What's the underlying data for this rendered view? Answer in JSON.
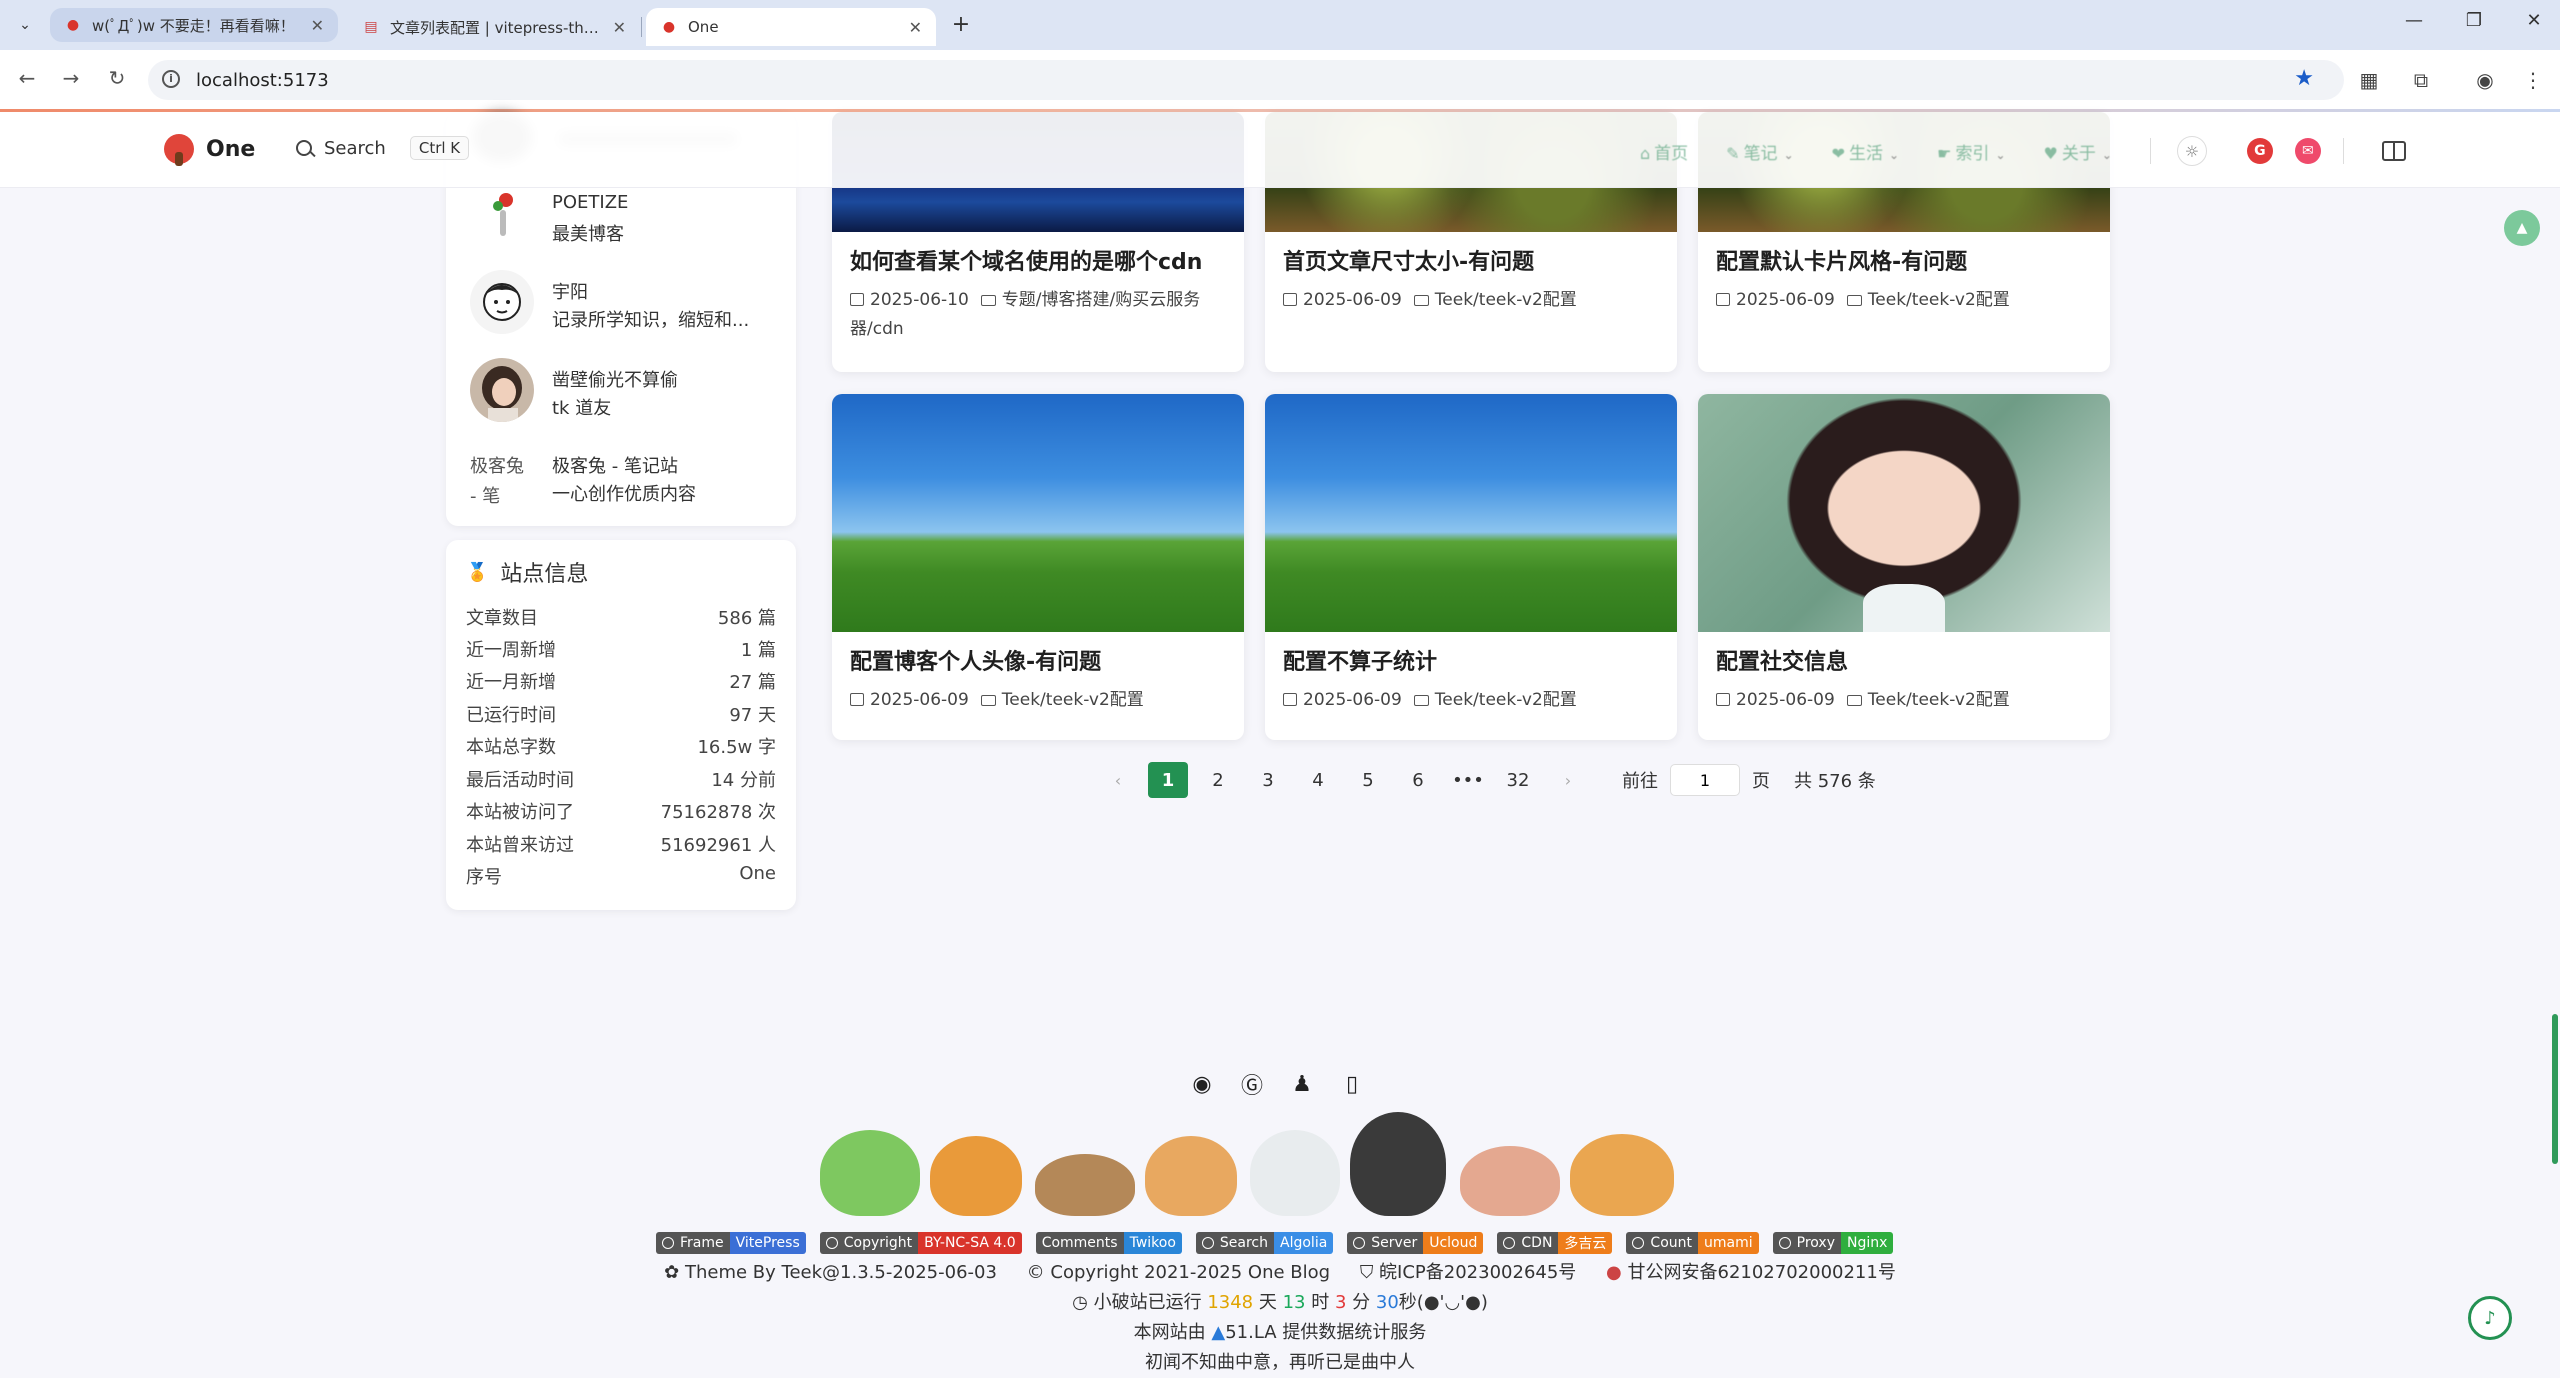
{
  "browser": {
    "tabs": [
      {
        "title": "w(ﾟДﾟ)w 不要走！再看看嘛！",
        "favicon": "tree-icon"
      },
      {
        "title": "文章列表配置 | vitepress-theme-teek",
        "favicon": "doc-icon"
      },
      {
        "title": "One",
        "favicon": "tree-icon",
        "active": true
      }
    ],
    "url": "localhost:5173"
  },
  "header": {
    "site_name": "One",
    "search_label": "Search",
    "search_kbd": "Ctrl K",
    "nav": [
      "首页",
      "笔记",
      "生活",
      "索引",
      "关于"
    ]
  },
  "friends": [
    {
      "name": "POETIZE",
      "desc": "最美博客"
    },
    {
      "name": "宇阳",
      "desc": "记录所学知识，缩短和..."
    },
    {
      "name": "凿壁偷光不算偷",
      "desc": "tk 道友"
    },
    {
      "name": "极客兔 - 笔记站",
      "desc": "一心创作优质内容",
      "alt": "极客兔 - 笔"
    }
  ],
  "site_info": {
    "title": "站点信息",
    "rows": [
      {
        "label": "文章数目",
        "value": "586 篇"
      },
      {
        "label": "近一周新增",
        "value": "1 篇"
      },
      {
        "label": "近一月新增",
        "value": "27 篇"
      },
      {
        "label": "已运行时间",
        "value": "97 天"
      },
      {
        "label": "本站总字数",
        "value": "16.5w 字"
      },
      {
        "label": "最后活动时间",
        "value": "14 分前"
      },
      {
        "label": "本站被访问了",
        "value": "75162878 次"
      },
      {
        "label": "本站曾来访过",
        "value": "51692961 人"
      },
      {
        "label": "序号",
        "value": "One"
      }
    ]
  },
  "articles": [
    {
      "title": "如何查看某个域名使用的是哪个cdn",
      "date": "2025-06-10",
      "category": "专题/博客搭建/购买云服务器/cdn"
    },
    {
      "title": "首页文章尺寸太小-有问题",
      "date": "2025-06-09",
      "category": "Teek/teek-v2配置"
    },
    {
      "title": "配置默认卡片风格-有问题",
      "date": "2025-06-09",
      "category": "Teek/teek-v2配置"
    },
    {
      "title": "配置博客个人头像-有问题",
      "date": "2025-06-09",
      "category": "Teek/teek-v2配置"
    },
    {
      "title": "配置不算子统计",
      "date": "2025-06-09",
      "category": "Teek/teek-v2配置"
    },
    {
      "title": "配置社交信息",
      "date": "2025-06-09",
      "category": "Teek/teek-v2配置"
    }
  ],
  "pagination": {
    "prev": "‹",
    "pages": [
      "1",
      "2",
      "3",
      "4",
      "5",
      "6",
      "•••",
      "32"
    ],
    "next": "›",
    "goto_label": "前往",
    "goto_value": "1",
    "page_unit": "页",
    "total": "共 576 条"
  },
  "footer": {
    "badges": [
      {
        "left": "Frame",
        "right": "VitePress",
        "color": "#3b6fd6"
      },
      {
        "left": "Copyright",
        "right": "BY-NC-SA 4.0",
        "color": "#d9342b"
      },
      {
        "left": "Comments",
        "right": "Twikoo",
        "color": "#2a86d8"
      },
      {
        "left": "Search",
        "right": "Algolia",
        "color": "#3a8ee6"
      },
      {
        "left": "Server",
        "right": "Ucloud",
        "color": "#ee7d1a"
      },
      {
        "left": "CDN",
        "right": "多吉云",
        "color": "#ee7d1a"
      },
      {
        "left": "Count",
        "right": "umami",
        "color": "#ee7d1a"
      },
      {
        "left": "Proxy",
        "right": "Nginx",
        "color": "#2fae3e"
      }
    ],
    "line1": {
      "theme": "Theme By Teek@1.3.5-2025-06-03",
      "copyright": "Copyright 2021-2025 One Blog",
      "icp": "皖ICP备2023002645号",
      "police": "甘公网安备62102702000211号"
    },
    "runtime": {
      "prefix": "小破站已运行",
      "days": "1348",
      "d_unit": "天",
      "hours": "13",
      "h_unit": "时",
      "minutes": "3",
      "m_unit": "分",
      "seconds": "30",
      "s_unit": "秒(●'◡'●)"
    },
    "stats": {
      "prefix": "本网站由",
      "brand": "51.LA",
      "suffix": "提供数据统计服务"
    },
    "quote": "初闻不知曲中意，再听已是曲中人"
  }
}
